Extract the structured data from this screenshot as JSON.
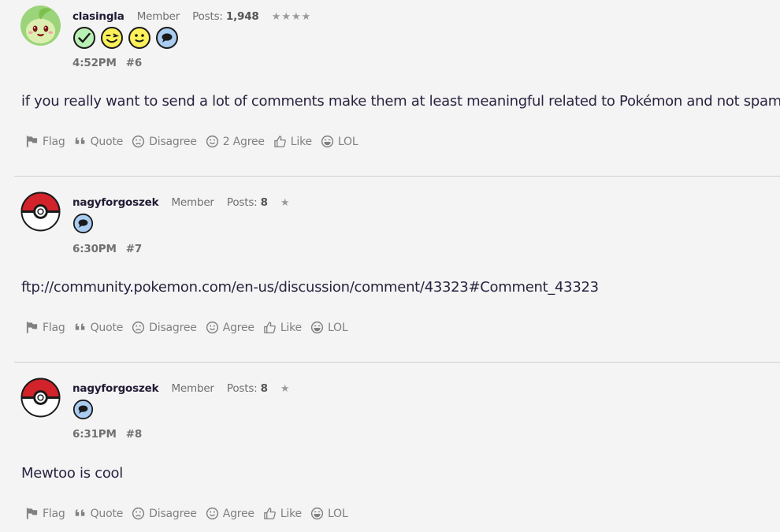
{
  "posts": [
    {
      "username": "clasingla",
      "role": "Member",
      "posts_label": "Posts:",
      "posts_count": "1,948",
      "stars": "★★★★",
      "time": "4:52PM",
      "number": "#6",
      "body": "if you really want to send a lot of comments make them at least meaningful related to Pokémon and not spam",
      "avatar": "chikorita-avatar",
      "badges": [
        "checkmark-badge-icon",
        "winking-face-badge-icon",
        "smiley-face-badge-icon",
        "speech-bubble-badge-icon"
      ],
      "actions": {
        "flag": "Flag",
        "quote": "Quote",
        "disagree": "Disagree",
        "agree": "2 Agree",
        "like": "Like",
        "lol": "LOL"
      }
    },
    {
      "username": "nagyforgoszek",
      "role": "Member",
      "posts_label": "Posts:",
      "posts_count": "8",
      "stars": "★",
      "time": "6:30PM",
      "number": "#7",
      "body": "ftp://community.pokemon.com/en-us/discussion/comment/43323#Comment_43323",
      "avatar": "pokeball-avatar",
      "badges": [
        "speech-bubble-badge-icon"
      ],
      "actions": {
        "flag": "Flag",
        "quote": "Quote",
        "disagree": "Disagree",
        "agree": "Agree",
        "like": "Like",
        "lol": "LOL"
      }
    },
    {
      "username": "nagyforgoszek",
      "role": "Member",
      "posts_label": "Posts:",
      "posts_count": "8",
      "stars": "★",
      "time": "6:31PM",
      "number": "#8",
      "body": "Mewtoo is cool",
      "avatar": "pokeball-avatar",
      "badges": [
        "speech-bubble-badge-icon"
      ],
      "actions": {
        "flag": "Flag",
        "quote": "Quote",
        "disagree": "Disagree",
        "agree": "Agree",
        "like": "Like",
        "lol": "LOL"
      }
    }
  ],
  "colors": {
    "background": "#f4f4f4",
    "text": "#2b2340",
    "muted": "#808080",
    "divider": "#cfcfcf",
    "badge_green": "#b9f0b4",
    "badge_yellow": "#fdf15a",
    "badge_blue": "#a9cdf0",
    "pokeball_red": "#d2232a"
  }
}
